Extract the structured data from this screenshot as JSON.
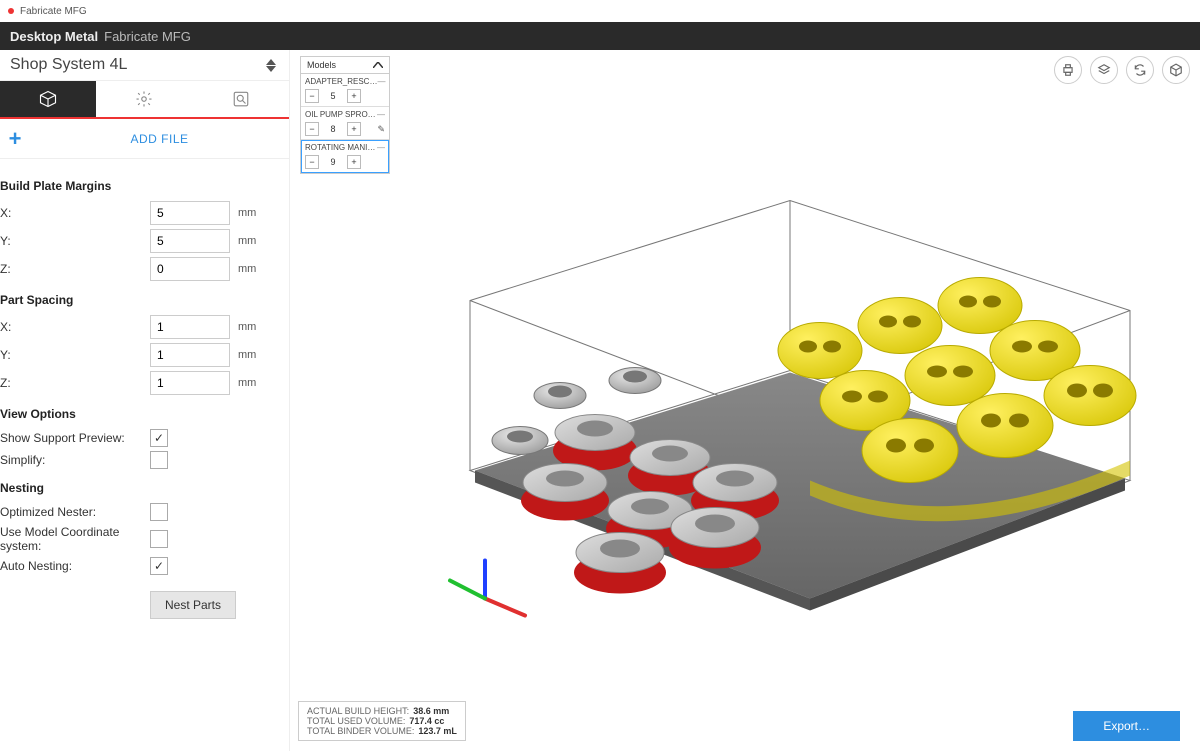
{
  "window": {
    "tab_label": "Fabricate MFG"
  },
  "header": {
    "brand": "Desktop Metal",
    "app": "Fabricate MFG"
  },
  "sidebar": {
    "system": "Shop System 4L",
    "add_file": "ADD FILE",
    "sections": {
      "build_margins": {
        "title": "Build Plate Margins",
        "x_label": "X:",
        "x_value": "5",
        "y_label": "Y:",
        "y_value": "5",
        "z_label": "Z:",
        "z_value": "0",
        "unit": "mm"
      },
      "part_spacing": {
        "title": "Part Spacing",
        "x_label": "X:",
        "x_value": "1",
        "y_label": "Y:",
        "y_value": "1",
        "z_label": "Z:",
        "z_value": "1",
        "unit": "mm"
      },
      "view_options": {
        "title": "View Options",
        "support_label": "Show Support Preview:",
        "support_checked": true,
        "simplify_label": "Simplify:",
        "simplify_checked": false
      },
      "nesting": {
        "title": "Nesting",
        "optimized_label": "Optimized Nester:",
        "optimized_checked": false,
        "coord_label": "Use Model Coordinate system:",
        "coord_checked": false,
        "auto_label": "Auto Nesting:",
        "auto_checked": true,
        "button": "Nest Parts"
      }
    }
  },
  "models_panel": {
    "title": "Models",
    "items": [
      {
        "name": "ADAPTER_RESC…",
        "qty": "5"
      },
      {
        "name": "OIL PUMP SPRO…",
        "qty": "8"
      },
      {
        "name": "ROTATING MANI…",
        "qty": "9"
      }
    ]
  },
  "stats": {
    "row1_label": "ACTUAL BUILD HEIGHT:",
    "row1_value": "38.6 mm",
    "row2_label": "TOTAL USED VOLUME:",
    "row2_value": "717.4 cc",
    "row3_label": "TOTAL BINDER VOLUME:",
    "row3_value": "123.7 mL"
  },
  "export_label": "Export…"
}
